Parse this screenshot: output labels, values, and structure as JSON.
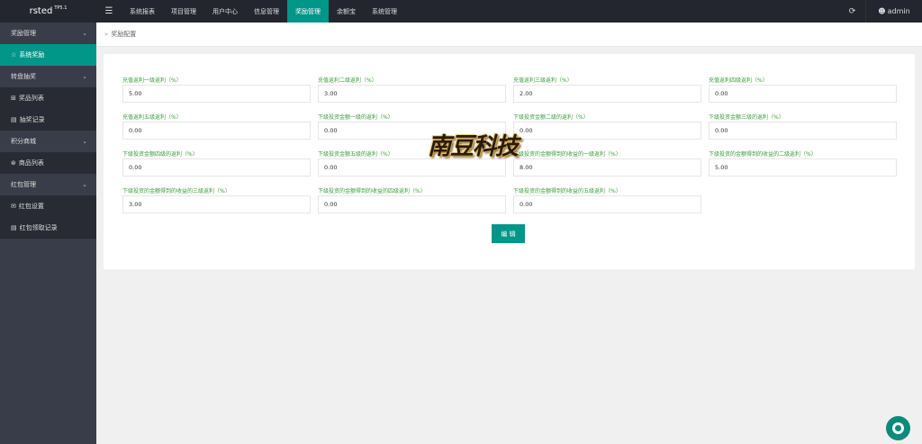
{
  "header": {
    "logo": "rsted",
    "version": "TP5.1",
    "menu_icon": "hamburger-icon",
    "nav": [
      "系统报表",
      "项目管理",
      "用户中心",
      "信息管理",
      "奖励管理",
      "余额宝",
      "系统管理"
    ],
    "active_nav": "奖励管理",
    "refresh_icon": "refresh-icon",
    "user_icon": "user-icon",
    "user": "admin"
  },
  "sidebar": {
    "groups": [
      {
        "label": "奖励管理",
        "items": [
          {
            "label": "系统奖励",
            "icon": "star-icon",
            "active": true
          }
        ]
      },
      {
        "label": "转盘抽奖",
        "items": [
          {
            "label": "奖品列表",
            "icon": "plus-square-icon"
          },
          {
            "label": "抽奖记录",
            "icon": "list-icon"
          }
        ]
      },
      {
        "label": "积分商城",
        "items": [
          {
            "label": "商品列表",
            "icon": "cart-icon"
          }
        ]
      },
      {
        "label": "红包管理",
        "items": [
          {
            "label": "红包设置",
            "icon": "mail-icon"
          },
          {
            "label": "红包领取记录",
            "icon": "card-icon"
          }
        ]
      }
    ]
  },
  "breadcrumb": {
    "separator": "»",
    "label": "奖励配置"
  },
  "form": {
    "fields": [
      {
        "label": "充值返利一级返利（%）",
        "value": "5.00"
      },
      {
        "label": "充值返利二级返利（%）",
        "value": "3.00"
      },
      {
        "label": "充值返利三级返利（%）",
        "value": "2.00"
      },
      {
        "label": "充值返利四级返利（%）",
        "value": "0.00"
      },
      {
        "label": "充值返利五级返利（%）",
        "value": "0.00"
      },
      {
        "label": "下级投资金额一级的返利（%）",
        "value": "0.00"
      },
      {
        "label": "下级投资金额二级的返利（%）",
        "value": "0.00"
      },
      {
        "label": "下级投资金额三级的返利（%）",
        "value": "0.00"
      },
      {
        "label": "下级投资金额四级的返利（%）",
        "value": "0.00"
      },
      {
        "label": "下级投资金额五级的返利（%）",
        "value": "0.00"
      },
      {
        "label": "下级投资的金额得到的收益的一级返利（%）",
        "value": "8.00"
      },
      {
        "label": "下级投资的金额得到的收益的二级返利（%）",
        "value": "5.00"
      },
      {
        "label": "下级投资的金额得到的收益的三级返利（%）",
        "value": "3.00"
      },
      {
        "label": "下级投资的金额得到的收益的四级返利（%）",
        "value": "0.00"
      },
      {
        "label": "下级投资的金额得到的收益的五级返利（%）",
        "value": "0.00"
      }
    ],
    "submit_label": "编 辑"
  },
  "watermark": "南豆科技",
  "fab_icon": "support-icon",
  "colors": {
    "accent": "#009688",
    "topbar": "#23262e",
    "sidebar": "#393d49",
    "sidebar_sub": "#282b33",
    "label": "#3c9c3c"
  }
}
